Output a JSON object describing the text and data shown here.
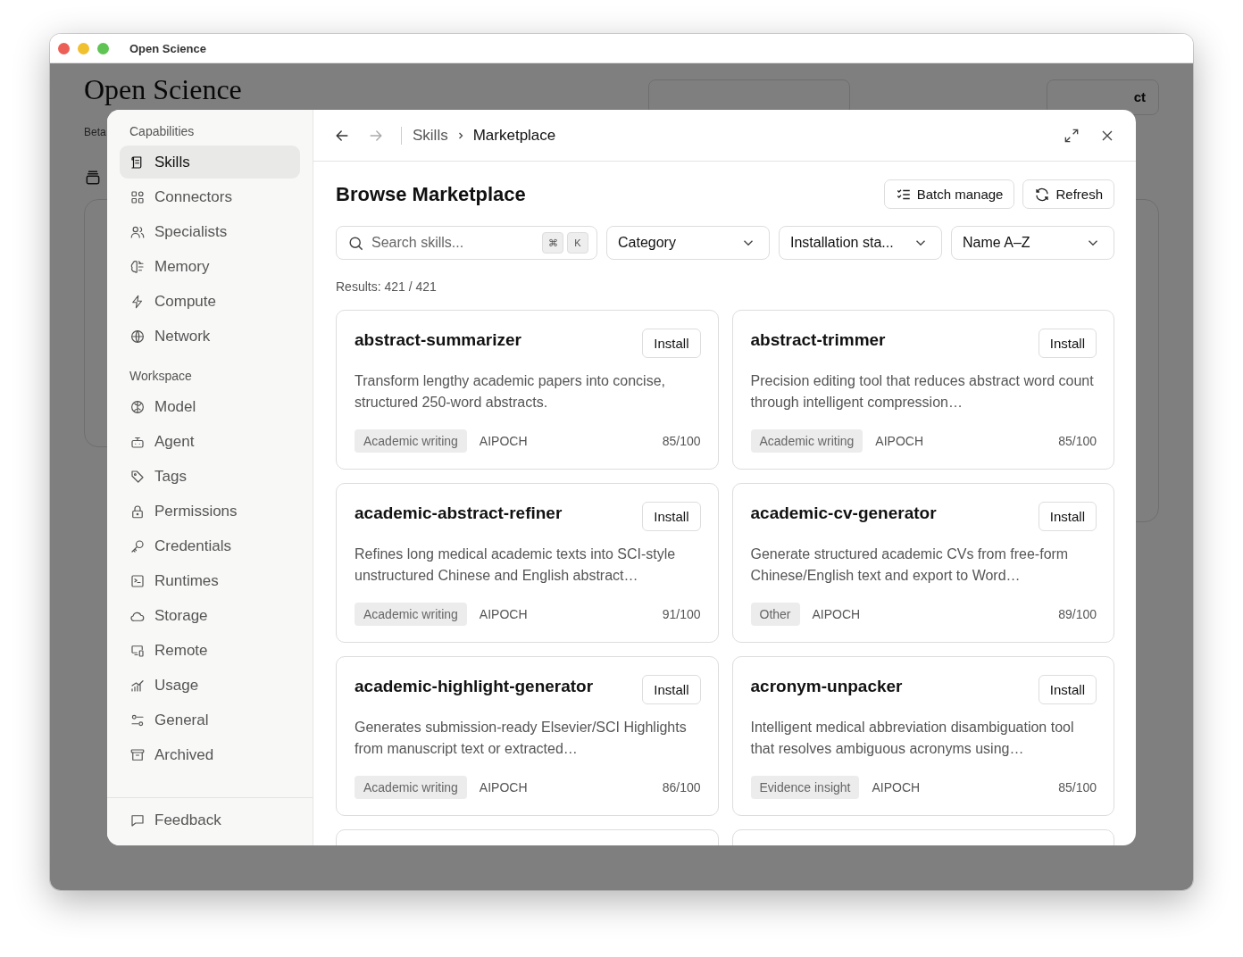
{
  "window": {
    "title": "Open Science"
  },
  "background": {
    "heading": "Open Science",
    "subtitle": "Beta",
    "button_text": "ct"
  },
  "sidebar": {
    "sections": [
      {
        "title": "Capabilities",
        "items": [
          {
            "label": "Skills",
            "selected": true
          },
          {
            "label": "Connectors",
            "selected": false
          },
          {
            "label": "Specialists",
            "selected": false
          },
          {
            "label": "Memory",
            "selected": false
          },
          {
            "label": "Compute",
            "selected": false
          },
          {
            "label": "Network",
            "selected": false
          }
        ]
      },
      {
        "title": "Workspace",
        "items": [
          {
            "label": "Model",
            "selected": false
          },
          {
            "label": "Agent",
            "selected": false
          },
          {
            "label": "Tags",
            "selected": false
          },
          {
            "label": "Permissions",
            "selected": false
          },
          {
            "label": "Credentials",
            "selected": false
          },
          {
            "label": "Runtimes",
            "selected": false
          },
          {
            "label": "Storage",
            "selected": false
          },
          {
            "label": "Remote",
            "selected": false
          },
          {
            "label": "Usage",
            "selected": false
          },
          {
            "label": "General",
            "selected": false
          },
          {
            "label": "Archived",
            "selected": false
          }
        ]
      }
    ],
    "footer_item": {
      "label": "Feedback"
    }
  },
  "nav": {
    "back_disabled": false,
    "forward_disabled": true,
    "breadcrumb": [
      "Skills",
      "Marketplace"
    ]
  },
  "page_title": "Browse Marketplace",
  "actions": [
    "Batch manage",
    "Refresh"
  ],
  "search": {
    "placeholder": "Search skills...",
    "shortcut": [
      "⌘",
      "K"
    ]
  },
  "filters": [
    "Category",
    "Installation sta...",
    "Name A–Z"
  ],
  "results": "Results: 421 / 421",
  "cards": [
    {
      "name": "abstract-summarizer",
      "button": "Install",
      "description": "Transform lengthy academic papers into concise, structured 250-word abstracts.",
      "tag": "Academic writing",
      "publisher": "AIPOCH",
      "score": "85/100"
    },
    {
      "name": "abstract-trimmer",
      "button": "Install",
      "description": "Precision editing tool that reduces abstract word count through intelligent compression…",
      "tag": "Academic writing",
      "publisher": "AIPOCH",
      "score": "85/100"
    },
    {
      "name": "academic-abstract-refiner",
      "button": "Install",
      "description": "Refines long medical academic texts into SCI-style unstructured Chinese and English abstract…",
      "tag": "Academic writing",
      "publisher": "AIPOCH",
      "score": "91/100"
    },
    {
      "name": "academic-cv-generator",
      "button": "Install",
      "description": "Generate structured academic CVs from free-form Chinese/English text and export to Word…",
      "tag": "Other",
      "publisher": "AIPOCH",
      "score": "89/100"
    },
    {
      "name": "academic-highlight-generator",
      "button": "Install",
      "description": "Generates submission-ready Elsevier/SCI Highlights from manuscript text or extracted…",
      "tag": "Academic writing",
      "publisher": "AIPOCH",
      "score": "86/100"
    },
    {
      "name": "acronym-unpacker",
      "button": "Install",
      "description": "Intelligent medical abbreviation disambiguation tool that resolves ambiguous acronyms using…",
      "tag": "Evidence insight",
      "publisher": "AIPOCH",
      "score": "85/100"
    }
  ]
}
